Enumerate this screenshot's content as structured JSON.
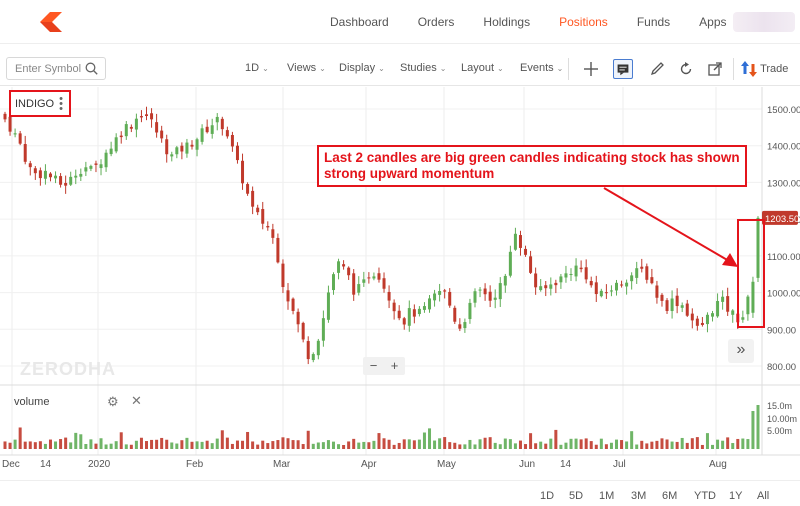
{
  "nav": {
    "items": [
      {
        "label": "Dashboard",
        "active": false
      },
      {
        "label": "Orders",
        "active": false
      },
      {
        "label": "Holdings",
        "active": false
      },
      {
        "label": "Positions",
        "active": true
      },
      {
        "label": "Funds",
        "active": false
      },
      {
        "label": "Apps",
        "active": false
      }
    ],
    "accent": "#ff5722"
  },
  "toolbar": {
    "search_placeholder": "Enter Symbol",
    "interval": "1D",
    "menus": [
      "Views",
      "Display",
      "Studies",
      "Layout",
      "Events"
    ],
    "trade_label": "Trade"
  },
  "chart": {
    "symbol": "INDIGO",
    "watermark": "ZERODHA",
    "annotation": "Last 2 candles are big green candles indicating stock has shown strong upward momentum",
    "last_price_label": "1203.50",
    "volume_label": "volume",
    "up_color": "#5fad56",
    "down_color": "#c0392b",
    "alert_color": "#e4141b",
    "zoom_out": "−",
    "zoom_in": "+",
    "expand": "»"
  },
  "ranges": [
    "1D",
    "5D",
    "1M",
    "3M",
    "6M",
    "YTD",
    "1Y",
    "All"
  ],
  "chart_data": {
    "type": "candlestick",
    "price_axis": {
      "ticks": [
        1500,
        1400,
        1300,
        1200,
        1100,
        1000,
        900,
        800
      ],
      "tick_labels": [
        "1500.00",
        "1400.00",
        "1300.00",
        "1200.00",
        "1100.00",
        "1000.00",
        "900.00",
        "800.00"
      ],
      "ylim": [
        770,
        1530
      ]
    },
    "volume_axis": {
      "tick_labels": [
        "15.0m",
        "10.00m",
        "5.00m"
      ]
    },
    "x_tick_labels": [
      "Dec",
      "14",
      "2020",
      "Feb",
      "Mar",
      "Apr",
      "May",
      "Jun",
      "14",
      "Jul",
      "Aug"
    ],
    "close_path": [
      1470,
      1440,
      1400,
      1340,
      1320,
      1330,
      1310,
      1295,
      1300,
      1330,
      1345,
      1330,
      1360,
      1390,
      1420,
      1450,
      1460,
      1490,
      1480,
      1440,
      1400,
      1370,
      1390,
      1400,
      1420,
      1440,
      1460,
      1470,
      1430,
      1360,
      1300,
      1230,
      1200,
      1180,
      1130,
      1020,
      960,
      900,
      830,
      850,
      930,
      1040,
      1080,
      1050,
      1000,
      1020,
      1060,
      1050,
      1000,
      960,
      920,
      950,
      940,
      960,
      990,
      1010,
      960,
      900,
      940,
      990,
      1010,
      980,
      1010,
      1040,
      1180,
      1120,
      1060,
      1000,
      1010,
      1030,
      1040,
      1060,
      1070,
      1050,
      1000,
      990,
      1010,
      1020,
      1040,
      1050,
      1060,
      1040,
      990,
      960,
      980,
      970,
      940,
      900,
      920,
      960,
      980,
      950,
      930,
      940,
      1040,
      1203.5
    ],
    "last_close": 1203.5
  }
}
